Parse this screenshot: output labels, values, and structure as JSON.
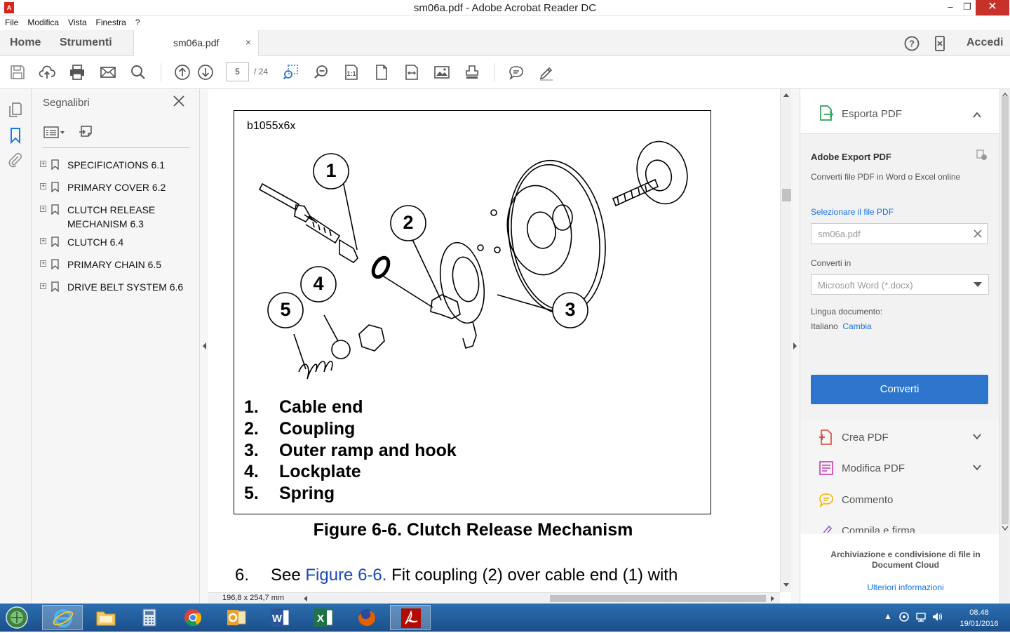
{
  "window": {
    "title": "sm06a.pdf - Adobe Acrobat Reader DC",
    "min": "–",
    "max": "❐",
    "close": "✕"
  },
  "menu": [
    "File",
    "Modifica",
    "Vista",
    "Finestra",
    "?"
  ],
  "tabs": {
    "home": "Home",
    "tools": "Strumenti",
    "document": "sm06a.pdf",
    "close": "×",
    "sign_in": "Accedi"
  },
  "toolbar": {
    "page_current": "5",
    "page_total": "/ 24"
  },
  "bookmarks": {
    "title": "Segnalibri",
    "items": [
      {
        "label": "SPECIFICATIONS 6.1"
      },
      {
        "label": "PRIMARY COVER 6.2"
      },
      {
        "label": "CLUTCH RELEASE MECHANISM 6.3"
      },
      {
        "label": "CLUTCH 6.4"
      },
      {
        "label": "PRIMARY CHAIN 6.5"
      },
      {
        "label": "DRIVE BELT SYSTEM 6.6"
      }
    ]
  },
  "document": {
    "figure_id": "b1055x6x",
    "callouts": [
      "1",
      "2",
      "3",
      "4",
      "5"
    ],
    "legend": [
      {
        "num": "1.",
        "text": "Cable end"
      },
      {
        "num": "2.",
        "text": "Coupling"
      },
      {
        "num": "3.",
        "text": "Outer ramp and hook"
      },
      {
        "num": "4.",
        "text": "Lockplate"
      },
      {
        "num": "5.",
        "text": "Spring"
      }
    ],
    "caption": "Figure 6-6. Clutch Release Mechanism",
    "para_num": "6.",
    "para_pre": "See ",
    "para_link": "Figure 6-6.",
    "para_post": " Fit coupling (2) over cable end (1) with",
    "page_size": "196,8 x 254,7 mm"
  },
  "right_panel": {
    "export_title": "Esporta PDF",
    "service_title": "Adobe Export PDF",
    "service_desc": "Converti file PDF in Word o Excel online",
    "select_file": "Selezionare il file PDF",
    "file_name": "sm06a.pdf",
    "convert_to_label": "Converti in",
    "convert_to_value": "Microsoft Word (*.docx)",
    "language_label": "Lingua documento:",
    "language_value": "Italiano",
    "language_change": "Cambia",
    "convert_button": "Converti",
    "tools": [
      {
        "label": "Crea PDF",
        "icon": "create-pdf-icon"
      },
      {
        "label": "Modifica PDF",
        "icon": "edit-pdf-icon"
      },
      {
        "label": "Commento",
        "icon": "comment-icon"
      },
      {
        "label": "Compila e firma",
        "icon": "fill-sign-icon"
      }
    ],
    "cloud_text": "Archiviazione e condivisione di file in Document Cloud",
    "cloud_link": "Ulteriori informazioni"
  },
  "taskbar": {
    "time": "08.48",
    "date": "19/01/2016"
  },
  "colors": {
    "accent": "#2d75cc",
    "link": "#1473e6",
    "taskbar": "#1c5a9a"
  }
}
